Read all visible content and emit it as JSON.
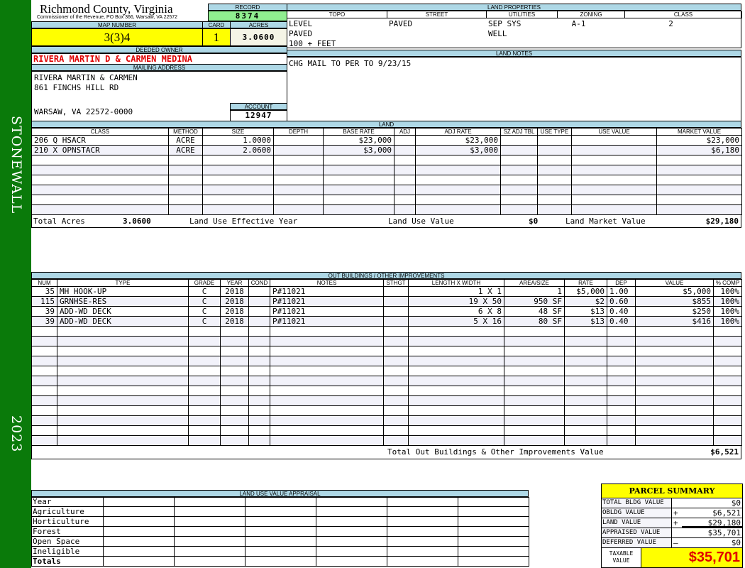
{
  "side": {
    "district": "STONEWALL",
    "year": "2023"
  },
  "header": {
    "county": "Richmond County, Virginia",
    "office": "Commissioner of the Revenue, PO Box 366, Warsaw, VA 22572",
    "record_label": "RECORD",
    "record": "8374",
    "map_label": "MAP NUMBER",
    "map": "3(3)4",
    "card_label": "CARD",
    "card": "1",
    "acres_label": "ACRES",
    "acres": "3.0600"
  },
  "land_props": {
    "title": "LAND PROPERTIES",
    "cols": [
      "TOPO",
      "STREET",
      "UTILITIES",
      "ZONING",
      "CLASS"
    ],
    "rows": [
      [
        "LEVEL",
        "PAVED",
        "SEP SYS",
        "A-1",
        "2"
      ],
      [
        "PAVED",
        "",
        "WELL",
        "",
        ""
      ],
      [
        "100 + FEET",
        "",
        "",
        "",
        ""
      ]
    ]
  },
  "owner": {
    "label": "DEEDED OWNER",
    "name": "RIVERA MARTIN D & CARMEN MEDINA",
    "mail_label": "MAILING ADDRESS",
    "line1": "RIVERA MARTIN & CARMEN",
    "line2": "861 FINCHS HILL RD",
    "line3": "WARSAW, VA 22572-0000",
    "account_label": "ACCOUNT",
    "account": "12947"
  },
  "notes": {
    "title": "LAND NOTES",
    "text": "CHG MAIL TO PER TO 9/23/15"
  },
  "land": {
    "title": "LAND",
    "cols": [
      "CLASS",
      "METHOD",
      "SIZE",
      "DEPTH",
      "BASE RATE",
      "ADJ",
      "ADJ RATE",
      "SZ ADJ TBL",
      "USE TYPE",
      "USE VALUE",
      "MARKET VALUE"
    ],
    "rows": [
      [
        "206 Q HSACR",
        "ACRE",
        "1.0000",
        "",
        "$23,000",
        "",
        "$23,000",
        "",
        "",
        "",
        "$23,000"
      ],
      [
        "210 X OPNSTACR",
        "ACRE",
        "2.0600",
        "",
        "$3,000",
        "",
        "$3,000",
        "",
        "",
        "",
        "$6,180"
      ]
    ],
    "total_acres_label": "Total Acres",
    "total_acres": "3.0600",
    "eff_year_label": "Land Use Effective Year",
    "use_value_label": "Land Use Value",
    "use_value": "$0",
    "market_label": "Land Market Value",
    "market": "$29,180"
  },
  "outbuildings": {
    "title": "OUT BUILDINGS / OTHER IMPROVEMENTS",
    "cols": [
      "NUM",
      "TYPE",
      "GRADE",
      "YEAR",
      "COND",
      "NOTES",
      "STHGT",
      "LENGTH X WIDTH",
      "AREA/SIZE",
      "RATE",
      "DEP",
      "VALUE",
      "% COMP"
    ],
    "rows": [
      [
        "35",
        "MH HOOK-UP",
        "C",
        "2018",
        "",
        "P#11021",
        "",
        "1 X 1",
        "1",
        "$5,000",
        "1.00",
        "$5,000",
        "100%"
      ],
      [
        "115",
        "GRNHSE-RES",
        "C",
        "2018",
        "",
        "P#11021",
        "",
        "19 X 50",
        "950 SF",
        "$2",
        "0.60",
        "$855",
        "100%"
      ],
      [
        "39",
        "ADD-WD DECK",
        "C",
        "2018",
        "",
        "P#11021",
        "",
        "6 X 8",
        "48 SF",
        "$13",
        "0.40",
        "$250",
        "100%"
      ],
      [
        "39",
        "ADD-WD DECK",
        "C",
        "2018",
        "",
        "P#11021",
        "",
        "5 X 16",
        "80 SF",
        "$13",
        "0.40",
        "$416",
        "100%"
      ]
    ],
    "total_label": "Total Out Buildings & Other Improvements Value",
    "total": "$6,521"
  },
  "land_use": {
    "title": "LAND USE VALUE APPRAISAL",
    "rows": [
      "Year",
      "Agriculture",
      "Horticulture",
      "Forest",
      "Open Space",
      "Ineligible",
      "Totals"
    ]
  },
  "summary": {
    "title": "PARCEL SUMMARY",
    "rows": [
      [
        "TOTAL BLDG VALUE",
        "",
        "$0"
      ],
      [
        "OBLDG VALUE",
        "+",
        "$6,521"
      ],
      [
        "LAND VALUE",
        "+",
        "$29,180"
      ],
      [
        "APPRAISED VALUE",
        "",
        "$35,701"
      ],
      [
        "DEFERRED VALUE",
        "–",
        "$0"
      ]
    ],
    "taxable_label": "TAXABLE VALUE",
    "taxable": "$35,701"
  }
}
